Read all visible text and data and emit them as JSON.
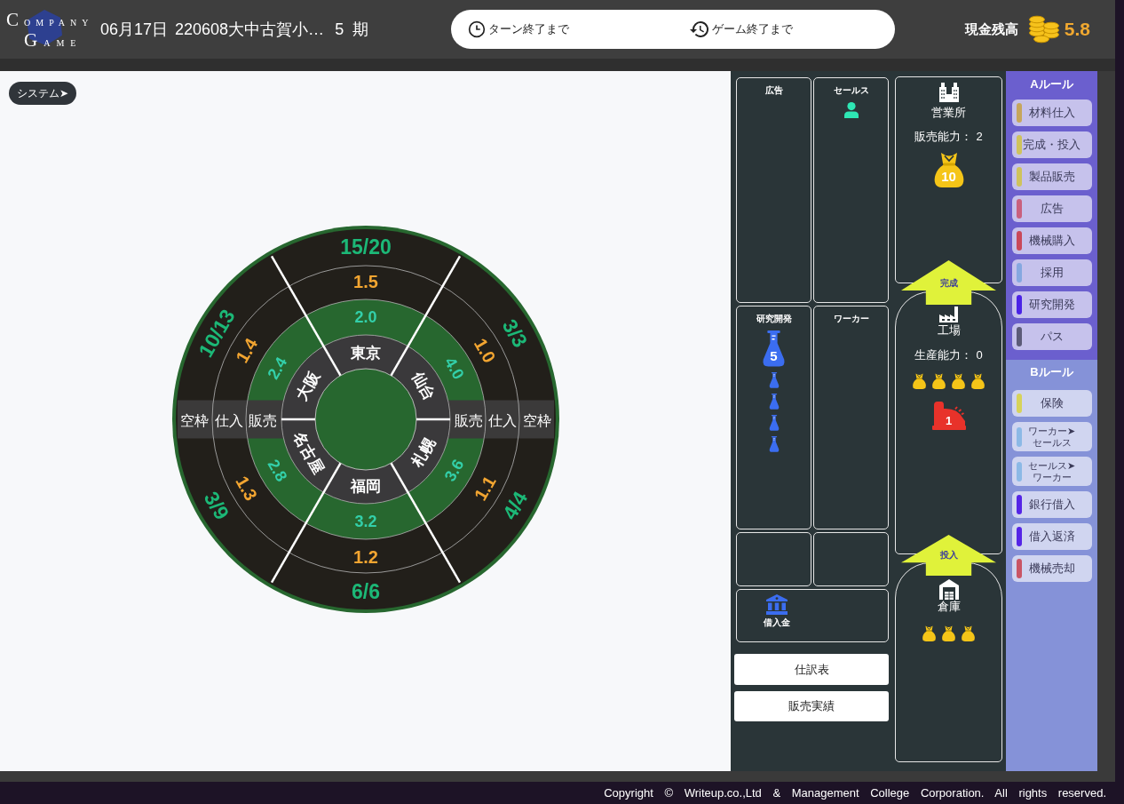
{
  "header": {
    "logo": {
      "line_1": "COMPANY",
      "line_2": "GAME"
    },
    "date": "06月17日",
    "game_name": "220608大中古賀小…",
    "period": "5",
    "period_unit": "期",
    "timers": [
      {
        "kind": "turn",
        "label": "ターン終了まで"
      },
      {
        "kind": "game",
        "label": "ゲーム終了まで"
      }
    ],
    "cash": {
      "label": "現金残高",
      "value": "5.8"
    }
  },
  "system_button": "システム➤",
  "market_board": {
    "band_left": [
      "空枠",
      "仕入",
      "販売"
    ],
    "band_right": [
      "販売",
      "仕入",
      "空枠"
    ],
    "markets": [
      {
        "city": "東京",
        "value_inner": "2.0",
        "value_outer": "1.5",
        "count": "15/20"
      },
      {
        "city": "仙台",
        "value_inner": "4.0",
        "value_outer": "1.0",
        "count": "3/3"
      },
      {
        "city": "札幌",
        "value_inner": "3.6",
        "value_outer": "1.1",
        "count": "4/4"
      },
      {
        "city": "福岡",
        "value_inner": "3.2",
        "value_outer": "1.2",
        "count": "6/6"
      },
      {
        "city": "名古屋",
        "value_inner": "2.8",
        "value_outer": "1.3",
        "count": "3/9"
      },
      {
        "city": "大阪",
        "value_inner": "2.4",
        "value_outer": "1.4",
        "count": "10/13"
      }
    ]
  },
  "company": {
    "cards": [
      {
        "title": "広告"
      },
      {
        "title": "セールス",
        "tokens": [
          {
            "kind": "person"
          }
        ]
      },
      {
        "title": "研究開発",
        "badge": "5",
        "tokens": [
          {
            "kind": "flask"
          },
          {
            "kind": "flask"
          },
          {
            "kind": "flask"
          },
          {
            "kind": "flask"
          }
        ]
      },
      {
        "title": "ワーカー"
      }
    ],
    "loan": {
      "label": "借入金"
    },
    "reports": [
      "仕訳表",
      "販売実績"
    ],
    "office": {
      "title": "営業所",
      "capacity_label": "販売能力：",
      "capacity": "2",
      "stock": "10"
    },
    "complete_arrow": "完成",
    "factory": {
      "title": "工場",
      "capacity_label": "生産能力：",
      "capacity": "0",
      "tokens": [
        {
          "kind": "bag"
        },
        {
          "kind": "bag"
        },
        {
          "kind": "bag"
        },
        {
          "kind": "bag"
        }
      ],
      "machines": [
        {
          "kind": "machine",
          "count": "1"
        }
      ]
    },
    "input_arrow": "投入",
    "warehouse": {
      "title": "倉庫",
      "tokens": [
        {
          "kind": "bag"
        },
        {
          "kind": "bag"
        },
        {
          "kind": "bag"
        }
      ]
    }
  },
  "rules": [
    {
      "title": "Aルール",
      "items": [
        {
          "label": "材料仕入",
          "color": "#c6a65c"
        },
        {
          "label": "完成・投入",
          "color": "#cfc35c"
        },
        {
          "label": "製品販売",
          "color": "#cfc35c"
        },
        {
          "label": "広告",
          "color": "#c9607e"
        },
        {
          "label": "機械購入",
          "color": "#c9485a"
        },
        {
          "label": "採用",
          "color": "#86a8e0"
        },
        {
          "label": "研究開発",
          "color": "#4b23e6"
        },
        {
          "label": "パス",
          "color": "#5c5b78"
        }
      ]
    },
    {
      "title": "Bルール",
      "items": [
        {
          "label": "保険",
          "color": "#d7d35a"
        },
        {
          "label": "ワーカー➤\nセールス",
          "color": "#8cb9e6"
        },
        {
          "label": "セールス➤\nワーカー",
          "color": "#8cb9e6"
        },
        {
          "label": "銀行借入",
          "color": "#5525e6"
        },
        {
          "label": "借入返済",
          "color": "#5525e6"
        },
        {
          "label": "機械売却",
          "color": "#c95565"
        }
      ]
    }
  ],
  "footer": {
    "copyright": "Copyright © Writeup.co.,Ltd & Management College Corporation. All rights reserved."
  }
}
